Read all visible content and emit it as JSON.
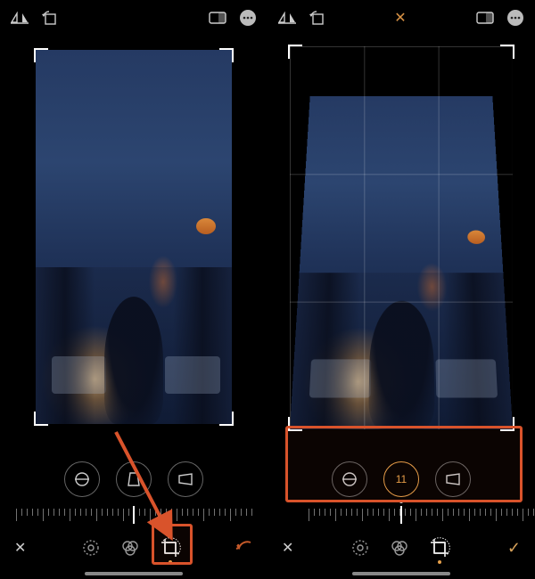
{
  "left": {
    "topbar": {
      "flip_icon": "flip-horizontal-icon",
      "rotate_icon": "rotate-icon",
      "aspect_icon": "aspect-ratio-icon",
      "more_icon": "more-icon"
    },
    "tools": {
      "straighten": "straighten-icon",
      "vertical": "perspective-vertical-icon",
      "horizontal": "perspective-horizontal-icon"
    },
    "bottom": {
      "cancel": "✕",
      "adjust_icon": "adjust-icon",
      "filters_icon": "filters-icon",
      "crop_icon": "crop-icon",
      "undo_icon": "undo-icon"
    }
  },
  "right": {
    "topbar": {
      "flip_icon": "flip-horizontal-icon",
      "rotate_icon": "rotate-icon",
      "reset_label": "✕",
      "aspect_icon": "aspect-ratio-icon",
      "more_icon": "more-icon"
    },
    "tools": {
      "straighten": "straighten-icon",
      "vertical_value": "11",
      "horizontal": "perspective-horizontal-icon"
    },
    "bottom": {
      "cancel": "✕",
      "adjust_icon": "adjust-icon",
      "filters_icon": "filters-icon",
      "crop_icon": "crop-icon",
      "done": "✓"
    }
  },
  "colors": {
    "accent": "#e6a04a",
    "highlight": "#d9532b"
  }
}
